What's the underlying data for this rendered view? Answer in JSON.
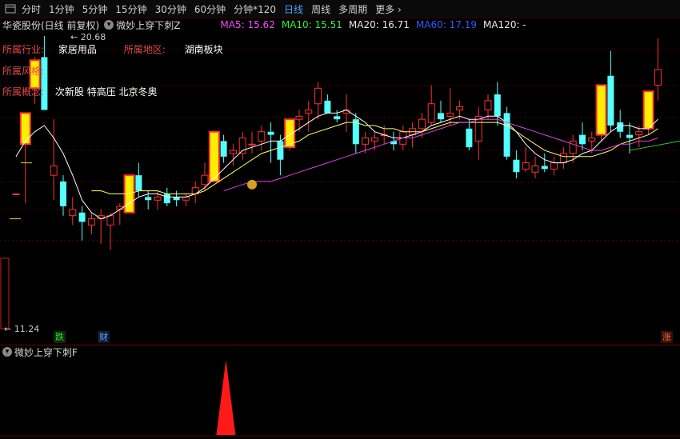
{
  "toolbar": {
    "items": [
      "分时",
      "1分钟",
      "5分钟",
      "15分钟",
      "30分钟",
      "60分钟",
      "分钟*120",
      "日线",
      "周线",
      "多周期",
      "更多"
    ],
    "active": "日线",
    "more_arrow": "›"
  },
  "header": {
    "stock": "华瓷股份(日线 前复权)",
    "indicator": "微妙上穿下刺Z",
    "ma": [
      {
        "label": "MA5: 15.62",
        "color": "#ff44ff"
      },
      {
        "label": "MA10: 15.51",
        "color": "#33ee33"
      },
      {
        "label": "MA20: 16.71",
        "color": "#e8e8e8"
      },
      {
        "label": "MA60: 17.19",
        "color": "#2b5bff"
      },
      {
        "label": "MA120: -",
        "color": "#e8e8e8"
      }
    ]
  },
  "info": {
    "industry_label": "所属行业:",
    "industry": "家居用品",
    "region_label": "所属地区:",
    "region": "湖南板块",
    "style_label": "所属风格:",
    "concept_label": "所属概念:",
    "concept": "次新股 特高压 北京冬奥"
  },
  "labels": {
    "high": "20.68",
    "low": "11.24"
  },
  "tags": {
    "die": "跌",
    "cai": "财",
    "zhang": "涨"
  },
  "sub": {
    "title": "微妙上穿下刺F"
  },
  "colors": {
    "up": "#ff3232",
    "down": "#54ffff",
    "signal_fill": "#ffee00",
    "ma_white": "#ffffff",
    "ma_yellow": "#ffff66",
    "ma_magenta": "#e040e0",
    "ma_green": "#33cc33"
  },
  "chart_data": {
    "type": "candlestick",
    "ylim": [
      11.24,
      20.68
    ],
    "candles": [
      {
        "o": 15.6,
        "h": 15.6,
        "l": 15.6,
        "c": 15.6
      },
      {
        "o": 17.2,
        "h": 17.2,
        "l": 15.3,
        "c": 18.2,
        "sig": true
      },
      {
        "o": 19.0,
        "h": 20.0,
        "l": 18.5,
        "c": 19.9,
        "sig": true
      },
      {
        "o": 20.0,
        "h": 20.68,
        "l": 18.4,
        "c": 18.3
      },
      {
        "o": 16.2,
        "h": 18.0,
        "l": 15.4,
        "c": 16.5
      },
      {
        "o": 16.0,
        "h": 16.2,
        "l": 14.9,
        "c": 15.2
      },
      {
        "o": 14.9,
        "h": 15.5,
        "l": 14.6,
        "c": 15.1
      },
      {
        "o": 15.0,
        "h": 15.2,
        "l": 14.1,
        "c": 14.7
      },
      {
        "o": 14.6,
        "h": 15.0,
        "l": 14.3,
        "c": 14.8
      },
      {
        "o": 14.8,
        "h": 15.1,
        "l": 14.0,
        "c": 14.9
      },
      {
        "o": 14.6,
        "h": 15.0,
        "l": 13.8,
        "c": 14.9
      },
      {
        "o": 15.1,
        "h": 15.3,
        "l": 14.6,
        "c": 15.2
      },
      {
        "o": 15.0,
        "h": 16.2,
        "l": 15.0,
        "c": 16.2,
        "sig": true
      },
      {
        "o": 16.2,
        "h": 16.6,
        "l": 15.5,
        "c": 15.7
      },
      {
        "o": 15.5,
        "h": 15.7,
        "l": 15.1,
        "c": 15.4
      },
      {
        "o": 15.4,
        "h": 15.7,
        "l": 15.1,
        "c": 15.5
      },
      {
        "o": 15.6,
        "h": 15.8,
        "l": 15.2,
        "c": 15.3
      },
      {
        "o": 15.5,
        "h": 15.7,
        "l": 15.2,
        "c": 15.4
      },
      {
        "o": 15.4,
        "h": 15.6,
        "l": 15.2,
        "c": 15.5
      },
      {
        "o": 15.6,
        "h": 16.0,
        "l": 15.3,
        "c": 15.8
      },
      {
        "o": 15.9,
        "h": 16.6,
        "l": 15.7,
        "c": 16.2
      },
      {
        "o": 16.0,
        "h": 17.6,
        "l": 16.0,
        "c": 17.6,
        "sig": true
      },
      {
        "o": 17.3,
        "h": 17.5,
        "l": 16.6,
        "c": 16.8
      },
      {
        "o": 16.9,
        "h": 17.2,
        "l": 16.5,
        "c": 17.0
      },
      {
        "o": 16.9,
        "h": 17.6,
        "l": 16.7,
        "c": 17.4
      },
      {
        "o": 17.2,
        "h": 17.6,
        "l": 16.9,
        "c": 17.2
      },
      {
        "o": 17.3,
        "h": 17.8,
        "l": 17.0,
        "c": 17.6
      },
      {
        "o": 17.6,
        "h": 17.9,
        "l": 16.6,
        "c": 17.5
      },
      {
        "o": 17.3,
        "h": 17.5,
        "l": 16.2,
        "c": 16.7
      },
      {
        "o": 17.1,
        "h": 18.0,
        "l": 17.0,
        "c": 18.0,
        "sig": true
      },
      {
        "o": 18.0,
        "h": 18.3,
        "l": 17.6,
        "c": 18.1
      },
      {
        "o": 18.2,
        "h": 18.6,
        "l": 17.6,
        "c": 18.3
      },
      {
        "o": 18.5,
        "h": 19.2,
        "l": 18.0,
        "c": 19.0
      },
      {
        "o": 18.6,
        "h": 18.8,
        "l": 18.2,
        "c": 18.2
      },
      {
        "o": 18.1,
        "h": 18.3,
        "l": 17.9,
        "c": 18.0
      },
      {
        "o": 18.2,
        "h": 18.8,
        "l": 17.6,
        "c": 18.3
      },
      {
        "o": 18.0,
        "h": 18.2,
        "l": 16.9,
        "c": 17.2
      },
      {
        "o": 17.2,
        "h": 17.6,
        "l": 16.9,
        "c": 17.4
      },
      {
        "o": 17.3,
        "h": 17.6,
        "l": 17.0,
        "c": 17.4
      },
      {
        "o": 17.5,
        "h": 17.8,
        "l": 17.2,
        "c": 17.5
      },
      {
        "o": 17.3,
        "h": 17.6,
        "l": 17.0,
        "c": 17.2
      },
      {
        "o": 17.2,
        "h": 17.8,
        "l": 17.0,
        "c": 17.6
      },
      {
        "o": 17.5,
        "h": 17.9,
        "l": 17.1,
        "c": 17.7
      },
      {
        "o": 17.7,
        "h": 18.2,
        "l": 17.4,
        "c": 18.0
      },
      {
        "o": 17.9,
        "h": 19.1,
        "l": 17.8,
        "c": 18.5
      },
      {
        "o": 18.2,
        "h": 18.6,
        "l": 17.9,
        "c": 18.0
      },
      {
        "o": 18.1,
        "h": 19.0,
        "l": 17.8,
        "c": 18.2
      },
      {
        "o": 18.3,
        "h": 18.6,
        "l": 18.0,
        "c": 18.4
      },
      {
        "o": 17.7,
        "h": 18.0,
        "l": 17.0,
        "c": 17.1
      },
      {
        "o": 17.3,
        "h": 18.4,
        "l": 16.7,
        "c": 18.1
      },
      {
        "o": 18.3,
        "h": 18.8,
        "l": 18.0,
        "c": 18.6
      },
      {
        "o": 18.8,
        "h": 19.2,
        "l": 17.8,
        "c": 18.1
      },
      {
        "o": 18.2,
        "h": 18.4,
        "l": 16.7,
        "c": 16.8
      },
      {
        "o": 16.7,
        "h": 17.0,
        "l": 16.1,
        "c": 16.3
      },
      {
        "o": 16.4,
        "h": 17.1,
        "l": 16.3,
        "c": 16.6
      },
      {
        "o": 16.3,
        "h": 16.8,
        "l": 16.1,
        "c": 16.5
      },
      {
        "o": 16.5,
        "h": 16.9,
        "l": 16.3,
        "c": 16.4
      },
      {
        "o": 16.4,
        "h": 16.8,
        "l": 16.2,
        "c": 16.6
      },
      {
        "o": 16.6,
        "h": 17.1,
        "l": 16.4,
        "c": 16.9
      },
      {
        "o": 16.9,
        "h": 17.5,
        "l": 16.6,
        "c": 17.3
      },
      {
        "o": 17.5,
        "h": 17.9,
        "l": 17.0,
        "c": 17.2
      },
      {
        "o": 17.3,
        "h": 17.6,
        "l": 16.9,
        "c": 17.4
      },
      {
        "o": 17.5,
        "h": 19.1,
        "l": 17.3,
        "c": 19.1,
        "sig": true
      },
      {
        "o": 19.4,
        "h": 20.2,
        "l": 17.6,
        "c": 17.8
      },
      {
        "o": 17.9,
        "h": 18.3,
        "l": 17.4,
        "c": 17.6
      },
      {
        "o": 17.5,
        "h": 17.9,
        "l": 16.9,
        "c": 17.4
      },
      {
        "o": 17.5,
        "h": 17.8,
        "l": 17.1,
        "c": 17.6
      },
      {
        "o": 17.7,
        "h": 18.9,
        "l": 17.5,
        "c": 18.9,
        "sig": true
      },
      {
        "o": 19.1,
        "h": 20.6,
        "l": 18.6,
        "c": 19.6
      }
    ],
    "ma_white": [
      16.8,
      17.3,
      17.6,
      17.8,
      17.4,
      16.9,
      16.2,
      15.4,
      15.0,
      14.8,
      14.9,
      15.1,
      15.3,
      15.5,
      15.6,
      15.6,
      15.5,
      15.5,
      15.5,
      15.6,
      15.8,
      16.1,
      16.4,
      16.7,
      17.0,
      17.1,
      17.2,
      17.3,
      17.3,
      17.5,
      17.7,
      17.9,
      18.1,
      18.2,
      18.2,
      18.3,
      18.1,
      17.9,
      17.6,
      17.5,
      17.4,
      17.4,
      17.5,
      17.6,
      17.8,
      17.9,
      18.0,
      18.1,
      18.0,
      18.0,
      18.1,
      18.1,
      17.9,
      17.6,
      17.2,
      16.9,
      16.7,
      16.6,
      16.6,
      16.7,
      16.9,
      17.0,
      17.3,
      17.6,
      17.8,
      17.8,
      17.7,
      17.7,
      18.0
    ],
    "ma_yellow": [
      null,
      null,
      null,
      null,
      null,
      null,
      null,
      null,
      15.7,
      15.7,
      15.6,
      15.6,
      15.6,
      15.7,
      15.7,
      15.7,
      15.6,
      15.6,
      15.6,
      15.6,
      15.7,
      15.9,
      16.1,
      16.3,
      16.5,
      16.7,
      16.9,
      17.0,
      17.1,
      17.2,
      17.3,
      17.5,
      17.6,
      17.7,
      17.8,
      17.9,
      17.9,
      17.8,
      17.8,
      17.7,
      17.7,
      17.6,
      17.6,
      17.6,
      17.7,
      17.8,
      17.9,
      17.9,
      17.9,
      17.9,
      17.9,
      17.9,
      17.8,
      17.6,
      17.4,
      17.2,
      17.0,
      16.9,
      16.8,
      16.8,
      16.8,
      16.8,
      16.9,
      17.0,
      17.2,
      17.3,
      17.4,
      17.5,
      17.7
    ],
    "ma_magenta": [
      null,
      null,
      null,
      null,
      null,
      null,
      null,
      null,
      null,
      null,
      null,
      null,
      null,
      null,
      null,
      null,
      null,
      null,
      null,
      null,
      null,
      null,
      15.7,
      15.8,
      15.9,
      16.0,
      16.0,
      16.0,
      16.1,
      16.2,
      16.3,
      16.4,
      16.5,
      16.6,
      16.7,
      16.8,
      16.9,
      17.0,
      17.1,
      17.2,
      17.3,
      17.4,
      17.4,
      17.5,
      17.6,
      17.7,
      17.8,
      17.9,
      17.9,
      18.0,
      18.0,
      18.0,
      17.9,
      17.8,
      17.7,
      17.6,
      17.5,
      17.4,
      17.3,
      17.2,
      17.1,
      17.0,
      17.0,
      17.1,
      17.2,
      17.2,
      17.3,
      17.3,
      17.4
    ],
    "sub_spike": {
      "index": 23,
      "value": 1
    }
  }
}
